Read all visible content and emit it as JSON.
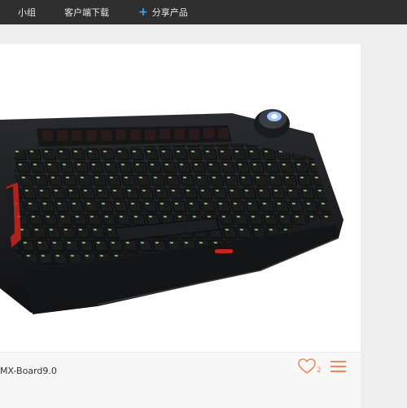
{
  "nav": {
    "group_label": "小组",
    "client_download_label": "客户端下载",
    "share_label": "分享产品",
    "share_icon": "plus-icon"
  },
  "product": {
    "name": "MX-Board9.0",
    "image": "keyboard-photo",
    "like_count": "2"
  },
  "colors": {
    "topbar": "#2f2f2f",
    "accent": "#f0875a",
    "plus": "#3fa9f5",
    "page_bg": "#eeeeee"
  }
}
